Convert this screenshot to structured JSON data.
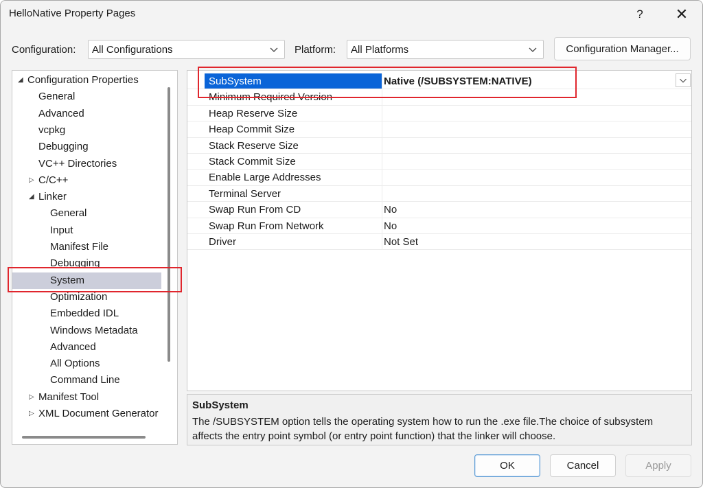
{
  "window": {
    "title": "HelloNative Property Pages",
    "help_glyph": "?",
    "close_glyph": "✕"
  },
  "config": {
    "configuration_label": "Configuration:",
    "configuration_value": "All Configurations",
    "platform_label": "Platform:",
    "platform_value": "All Platforms",
    "manager_button": "Configuration Manager..."
  },
  "tree": {
    "items": [
      {
        "label": "Configuration Properties",
        "arrow": "◢"
      },
      {
        "label": "General"
      },
      {
        "label": "Advanced"
      },
      {
        "label": "vcpkg"
      },
      {
        "label": "Debugging"
      },
      {
        "label": "VC++ Directories"
      },
      {
        "label": "C/C++",
        "arrow": "▷"
      },
      {
        "label": "Linker",
        "arrow": "◢"
      },
      {
        "label": "General"
      },
      {
        "label": "Input"
      },
      {
        "label": "Manifest File"
      },
      {
        "label": "Debugging"
      },
      {
        "label": "System",
        "selected": true
      },
      {
        "label": "Optimization"
      },
      {
        "label": "Embedded IDL"
      },
      {
        "label": "Windows Metadata"
      },
      {
        "label": "Advanced"
      },
      {
        "label": "All Options"
      },
      {
        "label": "Command Line"
      },
      {
        "label": "Manifest Tool",
        "arrow": "▷"
      },
      {
        "label": "XML Document Generator",
        "arrow": "▷"
      }
    ]
  },
  "grid": {
    "rows": [
      {
        "name": "SubSystem",
        "value": "Native (/SUBSYSTEM:NATIVE)",
        "selected": true
      },
      {
        "name": "Minimum Required Version",
        "value": ""
      },
      {
        "name": "Heap Reserve Size",
        "value": ""
      },
      {
        "name": "Heap Commit Size",
        "value": ""
      },
      {
        "name": "Stack Reserve Size",
        "value": ""
      },
      {
        "name": "Stack Commit Size",
        "value": ""
      },
      {
        "name": "Enable Large Addresses",
        "value": ""
      },
      {
        "name": "Terminal Server",
        "value": ""
      },
      {
        "name": "Swap Run From CD",
        "value": "No"
      },
      {
        "name": "Swap Run From Network",
        "value": "No"
      },
      {
        "name": "Driver",
        "value": "Not Set"
      }
    ]
  },
  "description": {
    "title": "SubSystem",
    "text": "The /SUBSYSTEM option tells the operating system how to run the .exe file.The choice of subsystem affects the entry point symbol (or entry point function) that the linker will choose."
  },
  "buttons": {
    "ok": "OK",
    "cancel": "Cancel",
    "apply": "Apply"
  },
  "colors": {
    "selection_blue": "#0a64d8",
    "tree_selection": "#cccedb",
    "highlight_red": "#e0262d"
  }
}
